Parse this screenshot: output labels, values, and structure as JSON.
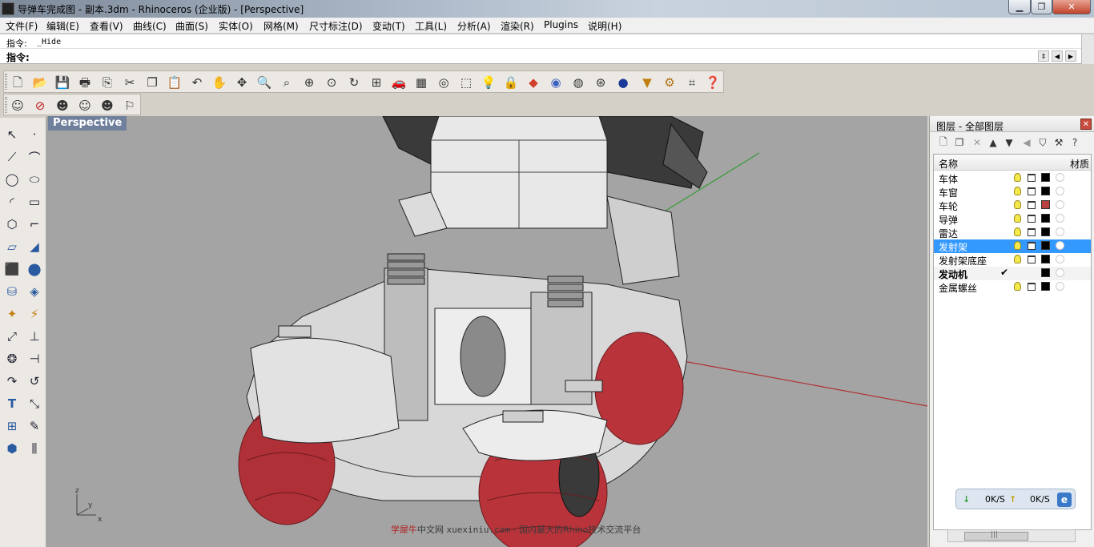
{
  "window": {
    "title": "导弹车完成图 - 副本.3dm - Rhinoceros (企业版) - [Perspective]",
    "min": "▁",
    "max": "❐",
    "close": "✕"
  },
  "menu": [
    "文件(F)",
    "编辑(E)",
    "查看(V)",
    "曲线(C)",
    "曲面(S)",
    "实体(O)",
    "网格(M)",
    "尺寸标注(D)",
    "变动(T)",
    "工具(L)",
    "分析(A)",
    "渲染(R)",
    "Plugins",
    "说明(H)"
  ],
  "command": {
    "history_label": "指令:",
    "history_value": "_Hide",
    "prompt_label": "指令:",
    "input_value": ""
  },
  "viewport": {
    "title": "Perspective",
    "axis_labels": {
      "z": "z",
      "y": "y",
      "x": "x"
    },
    "watermark": {
      "site": "学犀牛",
      "site2": "中文网",
      "url": "xuexiniu.com",
      "tagline": "- 国内最大的Rhino技术交流平台"
    }
  },
  "layers_panel": {
    "title": "图层 - 全部图层",
    "columns": {
      "name": "名称",
      "material": "材质"
    },
    "layers": [
      {
        "name": "车体",
        "color": "#000000",
        "selected": false,
        "current": false
      },
      {
        "name": "车窗",
        "color": "#000000",
        "selected": false,
        "current": false
      },
      {
        "name": "车轮",
        "color": "#b84040",
        "selected": false,
        "current": false
      },
      {
        "name": "导弹",
        "color": "#000000",
        "selected": false,
        "current": false
      },
      {
        "name": "雷达",
        "color": "#000000",
        "selected": false,
        "current": false
      },
      {
        "name": "发射架",
        "color": "#000000",
        "selected": true,
        "current": false
      },
      {
        "name": "发射架底座",
        "color": "#000000",
        "selected": false,
        "current": false
      },
      {
        "name": "发动机",
        "color": "#000000",
        "selected": false,
        "current": true
      },
      {
        "name": "金属螺丝",
        "color": "#000000",
        "selected": false,
        "current": false
      }
    ],
    "current_mark": "✔",
    "scroll_thumb": "|||"
  },
  "network": {
    "down": "0K/S",
    "up": "0K/S",
    "down_arrow": "↓",
    "up_arrow": "↑"
  },
  "icons": {
    "main_toolbar": [
      "new-file-icon",
      "open-folder-icon",
      "save-icon",
      "print-icon",
      "import-icon",
      "cut-icon",
      "copy-icon",
      "paste-icon",
      "undo-icon",
      "pan-hand-icon",
      "rotate-view-icon",
      "zoom-window-icon",
      "zoom-dynamic-icon",
      "zoom-extents-icon",
      "zoom-selected-icon",
      "rotate-camera-icon",
      "four-viewports-icon",
      "car-object-icon",
      "grid-plane-icon",
      "osnap-icon",
      "select-filter-icon",
      "light-icon",
      "lock-icon",
      "layer-color-icon",
      "color-wheel-icon",
      "wireframe-sphere-icon",
      "rendered-sphere-icon",
      "shaded-ball-icon",
      "paint-tool-icon",
      "options-gear-icon",
      "grid-settings-icon",
      "help-icon"
    ],
    "display_toolbar": [
      "show-icon",
      "hide-icon",
      "show-selected-icon",
      "hide-swap-icon",
      "lock-object-icon",
      "unlock-icon"
    ]
  }
}
